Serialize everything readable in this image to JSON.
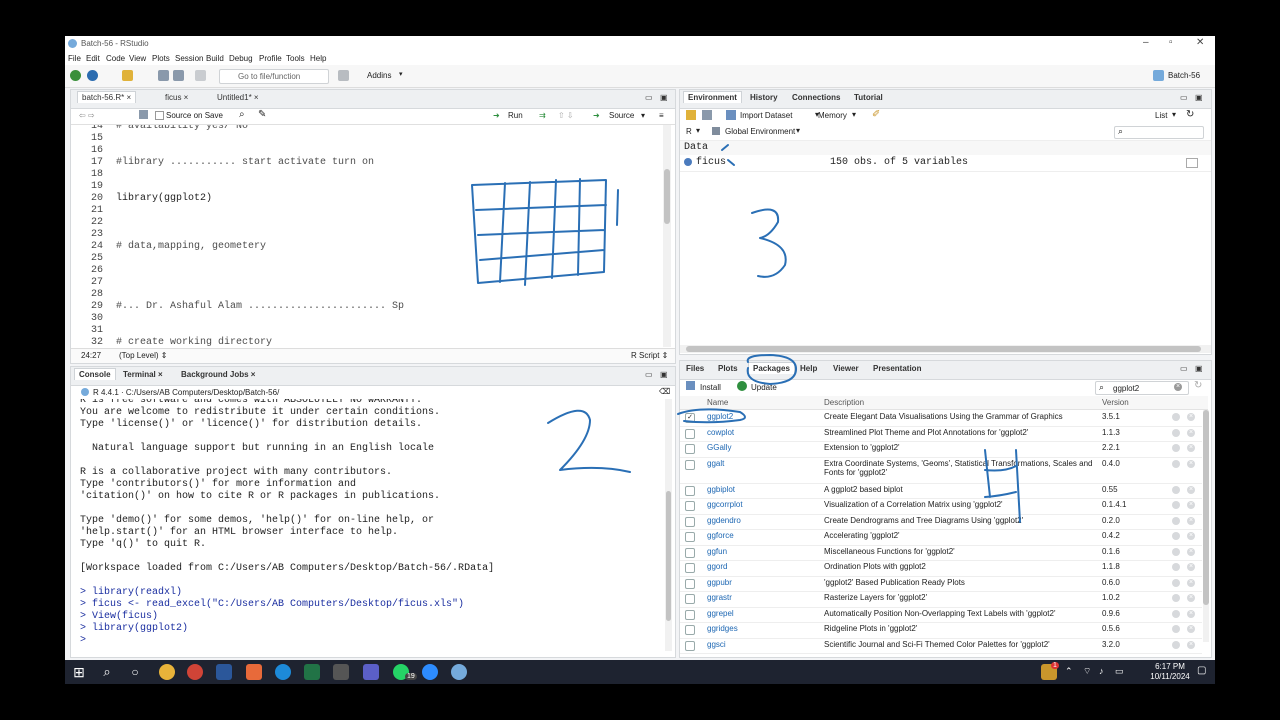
{
  "window": {
    "title": "Batch-56 - RStudio",
    "project": "Batch-56"
  },
  "menu": [
    "File",
    "Edit",
    "Code",
    "View",
    "Plots",
    "Session",
    "Build",
    "Debug",
    "Profile",
    "Tools",
    "Help"
  ],
  "toolbar": {
    "goto_placeholder": "Go to file/function",
    "addins": "Addins"
  },
  "source": {
    "tabs": [
      "batch-56.R*",
      "ficus",
      "Untitled1*"
    ],
    "source_on_save": "Source on Save",
    "run": "Run",
    "source_btn": "Source",
    "lines": [
      {
        "n": "14",
        "text": "# availability yes/ No"
      },
      {
        "n": "15",
        "text": ""
      },
      {
        "n": "16",
        "text": ""
      },
      {
        "n": "17",
        "text": "#library ........... start activate turn on"
      },
      {
        "n": "18",
        "text": ""
      },
      {
        "n": "19",
        "text": ""
      },
      {
        "n": "20",
        "text": "library(ggplot2)"
      },
      {
        "n": "21",
        "text": ""
      },
      {
        "n": "22",
        "text": ""
      },
      {
        "n": "23",
        "text": ""
      },
      {
        "n": "24",
        "text": "# data,mapping, geometery "
      },
      {
        "n": "25",
        "text": ""
      },
      {
        "n": "26",
        "text": ""
      },
      {
        "n": "27",
        "text": ""
      },
      {
        "n": "28",
        "text": ""
      },
      {
        "n": "29",
        "text": "#... Dr. Ashaful Alam ....................... Sp"
      },
      {
        "n": "30",
        "text": ""
      },
      {
        "n": "31",
        "text": ""
      },
      {
        "n": "32",
        "text": "# create working directory"
      }
    ],
    "status_pos": "24:27",
    "status_level": "(Top Level) ⇕",
    "status_type": "R Script ⇕"
  },
  "console": {
    "tabs": [
      "Console",
      "Terminal",
      "Background Jobs"
    ],
    "path": "R 4.4.1 · C:/Users/AB Computers/Desktop/Batch-56/",
    "lines": [
      {
        "t": "R is free software and comes with ABSOLUTELY NO WARRANTY.",
        "in": false
      },
      {
        "t": "You are welcome to redistribute it under certain conditions.",
        "in": false
      },
      {
        "t": "Type 'license()' or 'licence()' for distribution details.",
        "in": false
      },
      {
        "t": "",
        "in": false
      },
      {
        "t": "  Natural language support but running in an English locale",
        "in": false
      },
      {
        "t": "",
        "in": false
      },
      {
        "t": "R is a collaborative project with many contributors.",
        "in": false
      },
      {
        "t": "Type 'contributors()' for more information and",
        "in": false
      },
      {
        "t": "'citation()' on how to cite R or R packages in publications.",
        "in": false
      },
      {
        "t": "",
        "in": false
      },
      {
        "t": "Type 'demo()' for some demos, 'help()' for on-line help, or",
        "in": false
      },
      {
        "t": "'help.start()' for an HTML browser interface to help.",
        "in": false
      },
      {
        "t": "Type 'q()' to quit R.",
        "in": false
      },
      {
        "t": "",
        "in": false
      },
      {
        "t": "[Workspace loaded from C:/Users/AB Computers/Desktop/Batch-56/.RData]",
        "in": false
      },
      {
        "t": "",
        "in": false
      },
      {
        "t": "> library(readxl)",
        "in": true
      },
      {
        "t": "> ficus <- read_excel(\"C:/Users/AB Computers/Desktop/ficus.xls\")",
        "in": true
      },
      {
        "t": "> View(ficus)",
        "in": true
      },
      {
        "t": "> library(ggplot2)",
        "in": true
      },
      {
        "t": "> ",
        "in": true
      }
    ]
  },
  "environment": {
    "tabs": [
      "Environment",
      "History",
      "Connections",
      "Tutorial"
    ],
    "import_dataset": "Import Dataset",
    "memory": "Memory",
    "list": "List",
    "lang": "R",
    "global_env": "Global Environment",
    "section": "Data",
    "var_name": "ficus",
    "var_desc": "150 obs. of 5 variables"
  },
  "files": {
    "tabs": [
      "Files",
      "Plots",
      "Packages",
      "Help",
      "Viewer",
      "Presentation"
    ],
    "install": "Install",
    "update": "Update",
    "search_value": "ggplot2",
    "headers": {
      "name": "Name",
      "description": "Description",
      "version": "Version"
    },
    "packages": [
      {
        "name": "ggplot2",
        "desc": "Create Elegant Data Visualisations Using the Grammar of Graphics",
        "ver": "3.5.1",
        "checked": true
      },
      {
        "name": "cowplot",
        "desc": "Streamlined Plot Theme and Plot Annotations for 'ggplot2'",
        "ver": "1.1.3",
        "checked": false
      },
      {
        "name": "GGally",
        "desc": "Extension to 'ggplot2'",
        "ver": "2.2.1",
        "checked": false
      },
      {
        "name": "ggalt",
        "desc": "Extra Coordinate Systems, 'Geoms', Statistical Transformations, Scales and Fonts for 'ggplot2'",
        "ver": "0.4.0",
        "checked": false
      },
      {
        "name": "ggbiplot",
        "desc": "A ggplot2 based biplot",
        "ver": "0.55",
        "checked": false
      },
      {
        "name": "ggcorrplot",
        "desc": "Visualization of a Correlation Matrix using 'ggplot2'",
        "ver": "0.1.4.1",
        "checked": false
      },
      {
        "name": "ggdendro",
        "desc": "Create Dendrograms and Tree Diagrams Using 'ggplot2'",
        "ver": "0.2.0",
        "checked": false
      },
      {
        "name": "ggforce",
        "desc": "Accelerating 'ggplot2'",
        "ver": "0.4.2",
        "checked": false
      },
      {
        "name": "ggfun",
        "desc": "Miscellaneous Functions for 'ggplot2'",
        "ver": "0.1.6",
        "checked": false
      },
      {
        "name": "ggord",
        "desc": "Ordination Plots with ggplot2",
        "ver": "1.1.8",
        "checked": false
      },
      {
        "name": "ggpubr",
        "desc": "'ggplot2' Based Publication Ready Plots",
        "ver": "0.6.0",
        "checked": false
      },
      {
        "name": "ggrastr",
        "desc": "Rasterize Layers for 'ggplot2'",
        "ver": "1.0.2",
        "checked": false
      },
      {
        "name": "ggrepel",
        "desc": "Automatically Position Non-Overlapping Text Labels with 'ggplot2'",
        "ver": "0.9.6",
        "checked": false
      },
      {
        "name": "ggridges",
        "desc": "Ridgeline Plots in 'ggplot2'",
        "ver": "0.5.6",
        "checked": false
      },
      {
        "name": "ggsci",
        "desc": "Scientific Journal and Sci-Fi Themed Color Palettes for 'ggplot2'",
        "ver": "3.2.0",
        "checked": false
      }
    ]
  },
  "taskbar": {
    "time": "6:17 PM",
    "date": "10/11/2024",
    "badge_whatsapp": "19",
    "badge_tray": "1"
  },
  "colors": {
    "ink": "#2a6fb5",
    "accent": "#75aadb",
    "taskbar": "#1e2330"
  }
}
